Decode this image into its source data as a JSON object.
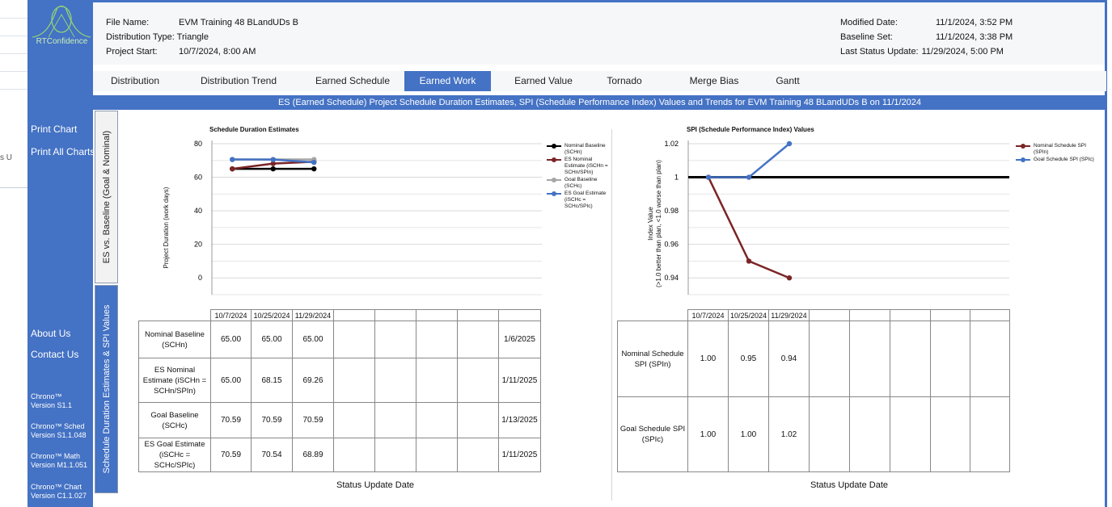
{
  "sidebar": {
    "logo_text": "RTConfidence",
    "nav": [
      "Print Chart",
      "Print All Charts",
      "About Us",
      "Contact Us"
    ],
    "versions": [
      {
        "name": "Chrono™",
        "version": "Version S1.1"
      },
      {
        "name": "Chrono™ Sched",
        "version": "Version S1.1.048"
      },
      {
        "name": "Chrono™ Math",
        "version": "Version M1.1.051"
      },
      {
        "name": "Chrono™ Chart",
        "version": "Version C1.1.027"
      }
    ]
  },
  "background_window": {
    "fragment": "s U"
  },
  "header": {
    "file_name_label": "File Name:",
    "file_name": "EVM Training 48 BLandUDs B",
    "distribution_type_label": "Distribution Type:",
    "distribution_type": "Triangle",
    "project_start_label": "Project Start:",
    "project_start": "10/7/2024, 8:00 AM",
    "modified_date_label": "Modified Date:",
    "modified_date": "11/1/2024, 3:52 PM",
    "baseline_set_label": "Baseline Set:",
    "baseline_set": "11/1/2024, 3:38 PM",
    "last_status_update_label": "Last Status Update:",
    "last_status_update": "11/29/2024, 5:00 PM"
  },
  "tabs": [
    "Distribution",
    "Distribution Trend",
    "Earned Schedule",
    "Earned Work",
    "Earned Value",
    "Tornado",
    "Merge Bias",
    "Gantt"
  ],
  "active_tab": "Earned Work",
  "title_bar": "ES (Earned Schedule) Project Schedule Duration Estimates, SPI (Schedule Performance Index) Values and Trends for EVM Training 48 BLandUDs B on 11/1/2024",
  "vertical_tabs": {
    "inactive": "ES vs. Baseline (Goal & Nominal)",
    "active": "Schedule Duration Estimates & SPI Values"
  },
  "colors": {
    "accent": "#4472c4",
    "black": "#000000",
    "maroon": "#7b2426",
    "gray": "#a6a6a6",
    "blue": "#4472c4"
  },
  "chart_data": [
    {
      "type": "line",
      "title": "Schedule Duration Estimates",
      "ylabel": "Project Duration (work days)",
      "xlabel": "Status Update Date",
      "ylim": [
        -10,
        80
      ],
      "yticks": [
        "80",
        "60",
        "40",
        "20",
        "0"
      ],
      "x": [
        "10/7/2024",
        "10/25/2024",
        "11/29/2024"
      ],
      "series": [
        {
          "name": "Nominal Baseline (SCHn)",
          "values": [
            65.0,
            65.0,
            65.0
          ],
          "color": "#000000"
        },
        {
          "name": "ES Nominal Estimate (iSCHn = SCHn/SPIn)",
          "values": [
            65.0,
            68.15,
            69.26
          ],
          "color": "#7b2426"
        },
        {
          "name": "Goal Baseline (SCHc)",
          "values": [
            70.59,
            70.59,
            70.59
          ],
          "color": "#a6a6a6"
        },
        {
          "name": "ES Goal Estimate (iSCHc = SCHc/SPIc)",
          "values": [
            70.59,
            70.54,
            68.89
          ],
          "color": "#4472c4"
        }
      ],
      "table": {
        "header": [
          "10/7/2024",
          "10/25/2024",
          "11/29/2024",
          "",
          "",
          "",
          "",
          ""
        ],
        "rows": [
          {
            "label": "Nominal Baseline (SCHn)",
            "cells": [
              "65.00",
              "65.00",
              "65.00",
              "",
              "",
              "",
              "",
              "1/6/2025"
            ]
          },
          {
            "label": "ES Nominal Estimate (iSCHn = SCHn/SPIn)",
            "cells": [
              "65.00",
              "68.15",
              "69.26",
              "",
              "",
              "",
              "",
              "1/11/2025"
            ]
          },
          {
            "label": "Goal Baseline (SCHc)",
            "cells": [
              "70.59",
              "70.59",
              "70.59",
              "",
              "",
              "",
              "",
              "1/13/2025"
            ]
          },
          {
            "label": "ES Goal Estimate (iSCHc = SCHc/SPIc)",
            "cells": [
              "70.59",
              "70.54",
              "68.89",
              "",
              "",
              "",
              "",
              "1/11/2025"
            ]
          }
        ]
      }
    },
    {
      "type": "line",
      "title": "SPI (Schedule Performance Index) Values",
      "ylabel": "Index Value",
      "ylabel2": "(>1.0 better than plan, <1.0 worse than plan)",
      "xlabel": "Status Update Date",
      "ylim": [
        0.93,
        1.02
      ],
      "yticks": [
        "1.02",
        "1",
        "0.98",
        "0.96",
        "0.94"
      ],
      "reference_line": 1.0,
      "x": [
        "10/7/2024",
        "10/25/2024",
        "11/29/2024"
      ],
      "series": [
        {
          "name": "Nominal Schedule SPI (SPIn)",
          "values": [
            1.0,
            0.95,
            0.94
          ],
          "color": "#7b2426"
        },
        {
          "name": "Goal Schedule SPI (SPIc)",
          "values": [
            1.0,
            1.0,
            1.02
          ],
          "color": "#4472c4"
        }
      ],
      "table": {
        "header": [
          "10/7/2024",
          "10/25/2024",
          "11/29/2024",
          "",
          "",
          "",
          "",
          ""
        ],
        "rows": [
          {
            "label": "Nominal Schedule SPI (SPIn)",
            "cells": [
              "1.00",
              "0.95",
              "0.94",
              "",
              "",
              "",
              "",
              ""
            ]
          },
          {
            "label": "Goal Schedule SPI (SPIc)",
            "cells": [
              "1.00",
              "1.00",
              "1.02",
              "",
              "",
              "",
              "",
              ""
            ]
          }
        ]
      }
    }
  ]
}
